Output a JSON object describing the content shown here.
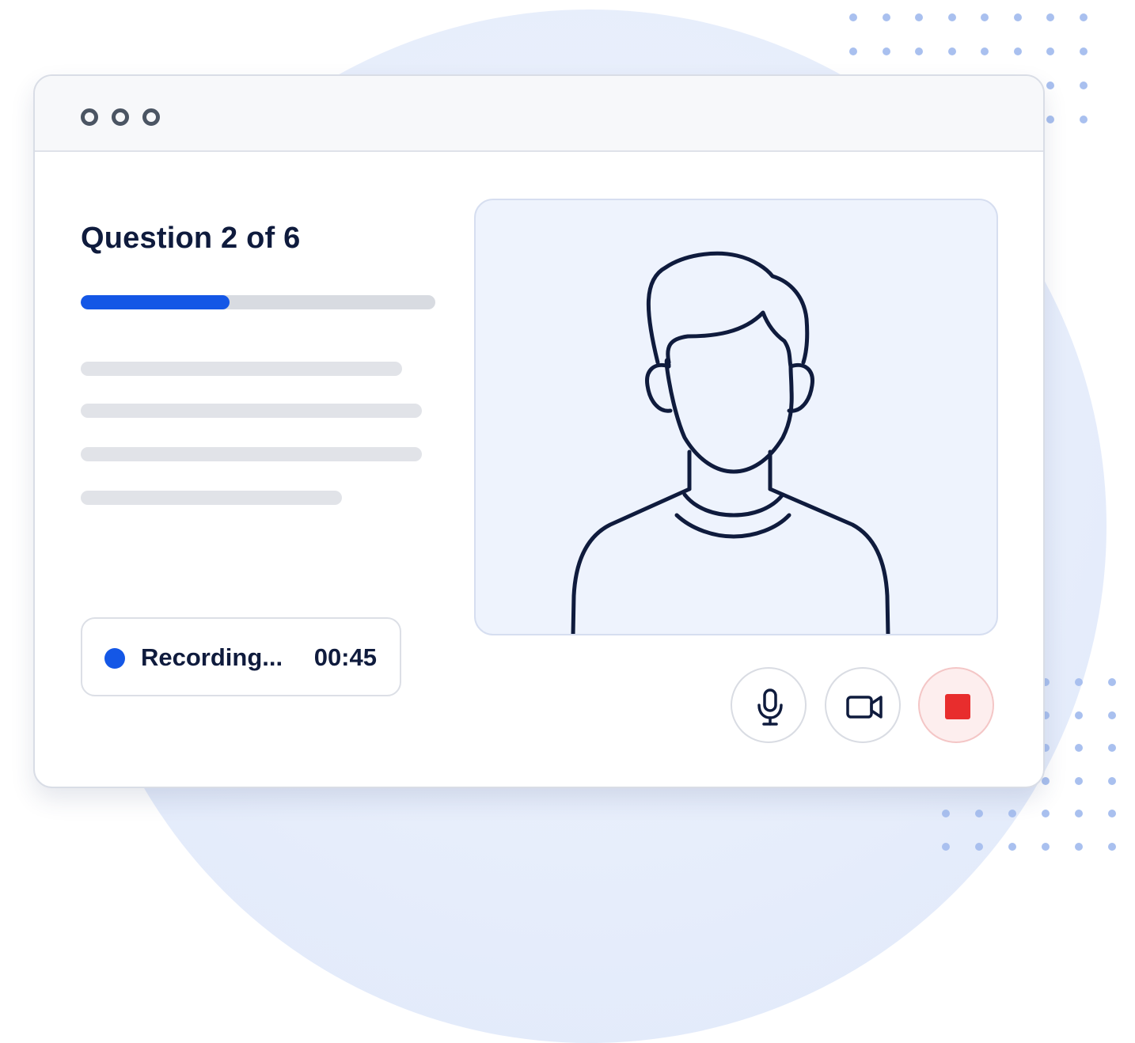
{
  "question": {
    "title": "Question 2 of 6",
    "current": 2,
    "total": 6,
    "progress_fraction": 0.42
  },
  "recording": {
    "label": "Recording...",
    "timer": "00:45"
  },
  "controls": {
    "microphone_icon": "microphone-icon",
    "camera_icon": "video-camera-icon",
    "stop_icon": "stop-icon"
  },
  "colors": {
    "accent": "#1457e6",
    "stop": "#e82d2d",
    "text": "#0f1b3d"
  }
}
